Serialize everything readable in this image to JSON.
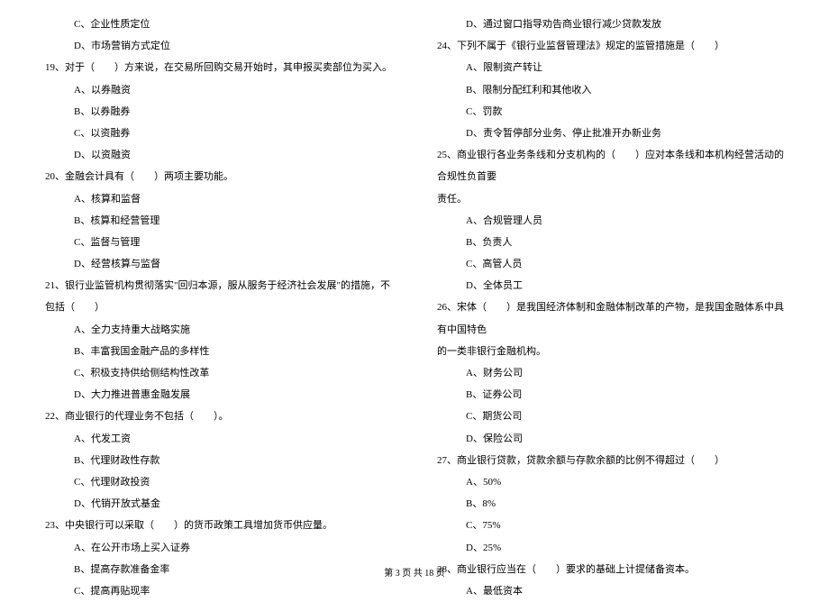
{
  "left": {
    "l0": "C、企业性质定位",
    "l1": "D、市场营销方式定位",
    "q19": "19、对于（　　）方来说，在交易所回购交易开始时，其申报买卖部位为买入。",
    "q19a": "A、以券融资",
    "q19b": "B、以券融券",
    "q19c": "C、以资融券",
    "q19d": "D、以资融资",
    "q20": "20、金融会计具有（　　）两项主要功能。",
    "q20a": "A、核算和监督",
    "q20b": "B、核算和经营管理",
    "q20c": "C、监督与管理",
    "q20d": "D、经营核算与监督",
    "q21": "21、银行业监管机构贯彻落实\"回归本源，服从服务于经济社会发展\"的措施，不包括（　　）",
    "q21a": "A、全力支持重大战略实施",
    "q21b": "B、丰富我国金融产品的多样性",
    "q21c": "C、积极支持供给侧结构性改革",
    "q21d": "D、大力推进普惠金融发展",
    "q22": "22、商业银行的代理业务不包括（　　）。",
    "q22a": "A、代发工资",
    "q22b": "B、代理财政性存款",
    "q22c": "C、代理财政投资",
    "q22d": "D、代销开放式基金",
    "q23": "23、中央银行可以采取（　　）的货币政策工具增加货币供应量。",
    "q23a": "A、在公开市场上买入证券",
    "q23b": "B、提高存款准备金率",
    "q23c": "C、提高再贴现率"
  },
  "right": {
    "r0": "D、通过窗口指导劝告商业银行减少贷款发放",
    "q24": "24、下列不属于《银行业监督管理法》规定的监管措施是（　　）",
    "q24a": "A、限制资产转让",
    "q24b": "B、限制分配红利和其他收入",
    "q24c": "C、罚款",
    "q24d": "D、责令暂停部分业务、停止批准开办新业务",
    "q25": "25、商业银行各业务条线和分支机构的（　　）应对本条线和本机构经营活动的合规性负首要",
    "q25cont": "责任。",
    "q25a": "A、合规管理人员",
    "q25b": "B、负责人",
    "q25c": "C、高管人员",
    "q25d": "D、全体员工",
    "q26": "26、宋体（　　）是我国经济体制和金融体制改革的产物，是我国金融体系中具有中国特色",
    "q26cont": "的一类非银行金融机构。",
    "q26a": "A、财务公司",
    "q26b": "B、证券公司",
    "q26c": "C、期货公司",
    "q26d": "D、保险公司",
    "q27": "27、商业银行贷款，贷款余额与存款余额的比例不得超过（　　）",
    "q27a": "A、50%",
    "q27b": "B、8%",
    "q27c": "C、75%",
    "q27d": "D、25%",
    "q28": "28、商业银行应当在（　　）要求的基础上计提储备资本。",
    "q28a": "A、最低资本"
  },
  "footer": "第 3 页 共 18 页"
}
